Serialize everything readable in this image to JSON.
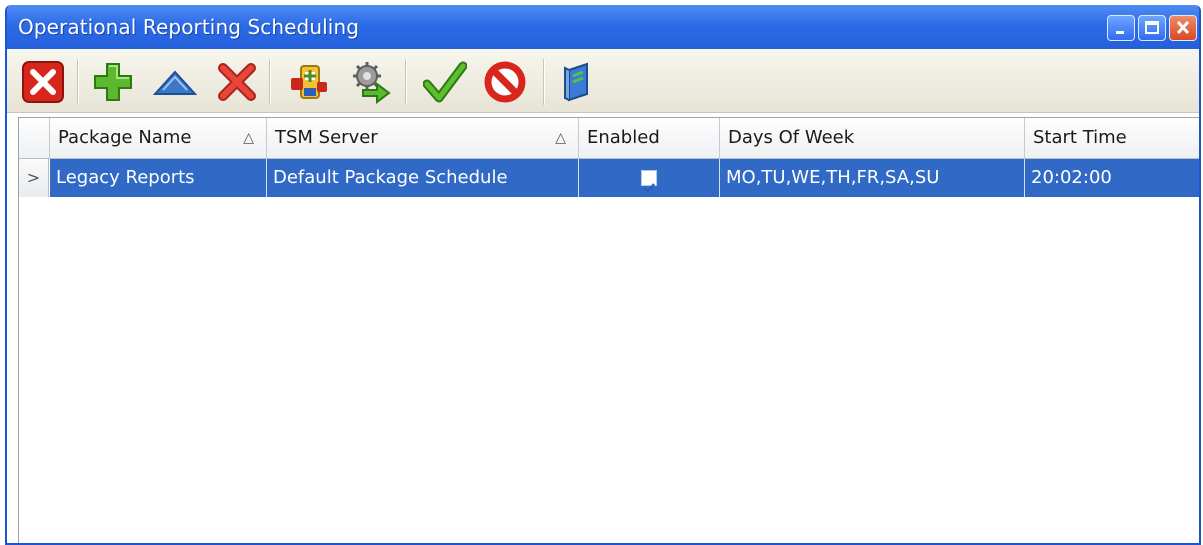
{
  "window": {
    "title": "Operational Reporting Scheduling"
  },
  "toolbar": {
    "buttons": [
      {
        "icon": "close-red-x-icon"
      },
      {
        "icon": "add-plus-icon"
      },
      {
        "icon": "move-up-icon"
      },
      {
        "icon": "delete-x-icon"
      },
      {
        "icon": "connect-package-icon"
      },
      {
        "icon": "run-schedule-icon"
      },
      {
        "icon": "enable-check-icon"
      },
      {
        "icon": "disable-icon"
      },
      {
        "icon": "help-book-icon"
      }
    ]
  },
  "grid": {
    "columns": [
      {
        "label": "Package Name",
        "sort": "△"
      },
      {
        "label": "TSM Server",
        "sort": "△"
      },
      {
        "label": "Enabled",
        "sort": ""
      },
      {
        "label": "Days Of Week",
        "sort": ""
      },
      {
        "label": "Start Time",
        "sort": ""
      }
    ],
    "rows": [
      {
        "indicator": ">",
        "package_name": "Legacy Reports",
        "tsm_server": "Default Package Schedule",
        "enabled": true,
        "days_of_week": "MO,TU,WE,TH,FR,SA,SU",
        "start_time": "20:02:00"
      }
    ]
  },
  "colors": {
    "titlebar": "#2c6be6",
    "selection": "#3169c6"
  }
}
